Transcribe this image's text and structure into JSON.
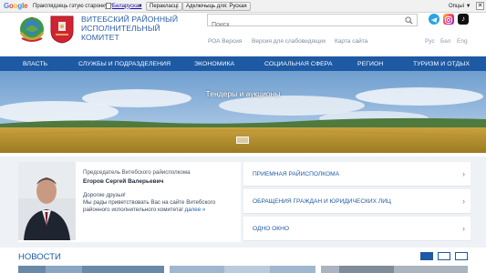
{
  "translate_bar": {
    "logo": "Google",
    "text": "Пракглядзець гэтую старонку ў:",
    "language": "Беларуская",
    "translate_button": "Перакласці",
    "disable_button": "Адключыць для: Руская",
    "options": "Опцыі ▼",
    "close": "✕"
  },
  "header": {
    "org_name": "Витебский районный исполнительный комитет",
    "search_placeholder": "Поиск",
    "links": [
      "РОА Версия",
      "Версия для слабовидящих",
      "Карта сайта"
    ],
    "langs": [
      "Рус",
      "Бел",
      "Eng"
    ],
    "social": [
      "telegram-icon",
      "instagram-icon",
      "tiktok-icon"
    ]
  },
  "nav": [
    "Власть",
    "Службы и подразделения",
    "Экономика",
    "Социальная сфера",
    "Регион",
    "Туризм и отдых"
  ],
  "banner": {
    "title": "Тендеры и аукционы"
  },
  "official": {
    "role": "Председатель Витебского райисполкома",
    "name": "Егоров Сергей Валерьевич",
    "greeting_line1": "Дорогие друзья!",
    "greeting_line2": "Мы рады приветствовать Вас на сайте Витебского районного исполнительного комитета!",
    "more": "далее »"
  },
  "side_links": [
    "Приемная райисполкома",
    "Обращения граждан и юридических лиц",
    "Одно окно"
  ],
  "news": {
    "title": "Новости"
  },
  "colors": {
    "brand": "#1e5aa3",
    "accent": "#2b5fa8"
  }
}
